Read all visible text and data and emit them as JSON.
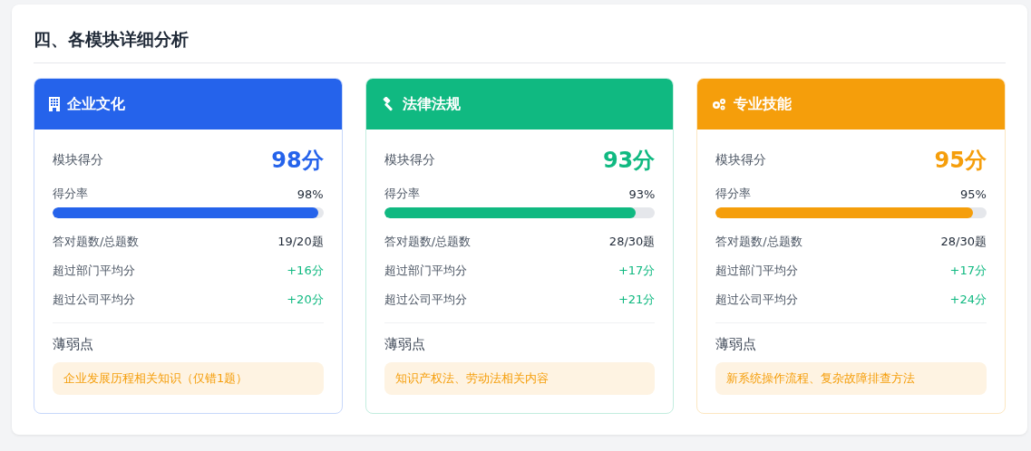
{
  "section_title": "四、各模块详细分析",
  "modules": [
    {
      "name": "企业文化",
      "kind": "building",
      "color": "#2563eb",
      "score_label": "模块得分",
      "score": "98分",
      "rate_label": "得分率",
      "rate": "98%",
      "level": 0.98,
      "stats": [
        {
          "label": "答对题数/总题数",
          "value": "19/20题",
          "kind": "plain"
        },
        {
          "label": "超过部门平均分",
          "value": "+16分",
          "kind": "gain"
        },
        {
          "label": "超过公司平均分",
          "value": "+20分",
          "kind": "gain"
        }
      ],
      "weak_label": "薄弱点",
      "weak": "企业发展历程相关知识（仅错1题）"
    },
    {
      "name": "法律法规",
      "kind": "gavel",
      "color": "#10b981",
      "score_label": "模块得分",
      "score": "93分",
      "rate_label": "得分率",
      "rate": "93%",
      "level": 0.93,
      "stats": [
        {
          "label": "答对题数/总题数",
          "value": "28/30题",
          "kind": "plain"
        },
        {
          "label": "超过部门平均分",
          "value": "+17分",
          "kind": "gain"
        },
        {
          "label": "超过公司平均分",
          "value": "+21分",
          "kind": "gain"
        }
      ],
      "weak_label": "薄弱点",
      "weak": "知识产权法、劳动法相关内容"
    },
    {
      "name": "专业技能",
      "kind": "gears",
      "color": "#f59e0b",
      "score_label": "模块得分",
      "score": "95分",
      "rate_label": "得分率",
      "rate": "95%",
      "level": 0.95,
      "stats": [
        {
          "label": "答对题数/总题数",
          "value": "28/30题",
          "kind": "plain"
        },
        {
          "label": "超过部门平均分",
          "value": "+17分",
          "kind": "gain"
        },
        {
          "label": "超过公司平均分",
          "value": "+24分",
          "kind": "gain"
        }
      ],
      "weak_label": "薄弱点",
      "weak": "新系统操作流程、复杂故障排查方法"
    }
  ]
}
